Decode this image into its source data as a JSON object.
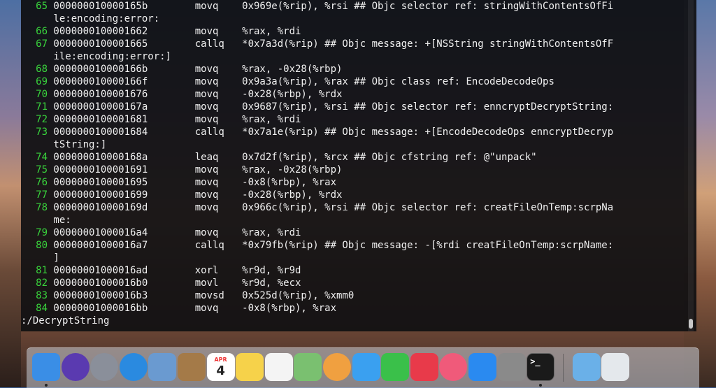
{
  "terminal": {
    "lines": [
      {
        "num": "65",
        "text": "000000010000165b        movq    0x969e(%rip), %rsi ## Objc selector ref: stringWithContentsOfFi"
      },
      {
        "num": "",
        "text": "le:encoding:error:"
      },
      {
        "num": "66",
        "text": "0000000100001662        movq    %rax, %rdi"
      },
      {
        "num": "67",
        "text": "0000000100001665        callq   *0x7a3d(%rip) ## Objc message: +[NSString stringWithContentsOfF"
      },
      {
        "num": "",
        "text": "ile:encoding:error:]"
      },
      {
        "num": "68",
        "text": "000000010000166b        movq    %rax, -0x28(%rbp)"
      },
      {
        "num": "69",
        "text": "000000010000166f        movq    0x9a3a(%rip), %rax ## Objc class ref: EncodeDecodeOps"
      },
      {
        "num": "70",
        "text": "0000000100001676        movq    -0x28(%rbp), %rdx"
      },
      {
        "num": "71",
        "text": "000000010000167a        movq    0x9687(%rip), %rsi ## Objc selector ref: enncryptDecryptString:"
      },
      {
        "num": "72",
        "text": "0000000100001681        movq    %rax, %rdi"
      },
      {
        "num": "73",
        "text": "0000000100001684        callq   *0x7a1e(%rip) ## Objc message: +[EncodeDecodeOps enncryptDecryp"
      },
      {
        "num": "",
        "text": "tString:]"
      },
      {
        "num": "74",
        "text": "000000010000168a        leaq    0x7d2f(%rip), %rcx ## Objc cfstring ref: @\"unpack\""
      },
      {
        "num": "75",
        "text": "0000000100001691        movq    %rax, -0x28(%rbp)"
      },
      {
        "num": "76",
        "text": "0000000100001695        movq    -0x8(%rbp), %rax"
      },
      {
        "num": "77",
        "text": "0000000100001699        movq    -0x28(%rbp), %rdx"
      },
      {
        "num": "78",
        "text": "000000010000169d        movq    0x966c(%rip), %rsi ## Objc selector ref: creatFileOnTemp:scrpNa"
      },
      {
        "num": "",
        "text": "me:"
      },
      {
        "num": "79",
        "text": "00000001000016a4        movq    %rax, %rdi"
      },
      {
        "num": "80",
        "text": "00000001000016a7        callq   *0x79fb(%rip) ## Objc message: -[%rdi creatFileOnTemp:scrpName:"
      },
      {
        "num": "",
        "text": "]"
      },
      {
        "num": "81",
        "text": "00000001000016ad        xorl    %r9d, %r9d"
      },
      {
        "num": "82",
        "text": "00000001000016b0        movl    %r9d, %ecx"
      },
      {
        "num": "83",
        "text": "00000001000016b3        movsd   0x525d(%rip), %xmm0"
      },
      {
        "num": "84",
        "text": "00000001000016bb        movq    -0x8(%rbp), %rax"
      }
    ],
    "prompt": ":/DecryptString"
  },
  "dock": {
    "items": [
      {
        "name": "finder-icon",
        "label": "",
        "color": "#3a8ee6",
        "running": true
      },
      {
        "name": "siri-icon",
        "label": "",
        "color": "#5a3ab0",
        "running": false
      },
      {
        "name": "launchpad-icon",
        "label": "",
        "color": "#8a8f9a",
        "running": false
      },
      {
        "name": "safari-icon",
        "label": "",
        "color": "#2a8ae0",
        "running": false
      },
      {
        "name": "preview-icon",
        "label": "",
        "color": "#6a9ad0",
        "running": false
      },
      {
        "name": "notefile-icon",
        "label": "",
        "color": "#a47a48",
        "running": false
      },
      {
        "name": "calendar-icon",
        "label": "4",
        "month": "APR",
        "color": "#ffffff",
        "running": false
      },
      {
        "name": "notes-icon",
        "label": "",
        "color": "#f6d24a",
        "running": false
      },
      {
        "name": "reminders-icon",
        "label": "",
        "color": "#f4f4f4",
        "running": false
      },
      {
        "name": "maps-icon",
        "label": "",
        "color": "#7ac070",
        "running": false
      },
      {
        "name": "photos-icon",
        "label": "",
        "color": "#f0a040",
        "running": false
      },
      {
        "name": "messages-icon",
        "label": "",
        "color": "#3aa0f0",
        "running": false
      },
      {
        "name": "facetime-icon",
        "label": "",
        "color": "#3ac04a",
        "running": false
      },
      {
        "name": "news-icon",
        "label": "",
        "color": "#e83a4a",
        "running": false
      },
      {
        "name": "music-icon",
        "label": "",
        "color": "#f05a7a",
        "running": false
      },
      {
        "name": "app-store-icon",
        "label": "",
        "color": "#2a8af0",
        "running": false
      },
      {
        "name": "system-preferences-icon",
        "label": "",
        "color": "#8a8a8a",
        "running": false
      },
      {
        "name": "terminal-icon",
        "label": ">_",
        "color": "#1a1a1a",
        "running": true
      },
      {
        "name": "downloads-folder-icon",
        "label": "",
        "color": "#6ab0e8",
        "running": false
      },
      {
        "name": "trash-icon",
        "label": "",
        "color": "#e4e8ec",
        "running": false
      }
    ]
  }
}
